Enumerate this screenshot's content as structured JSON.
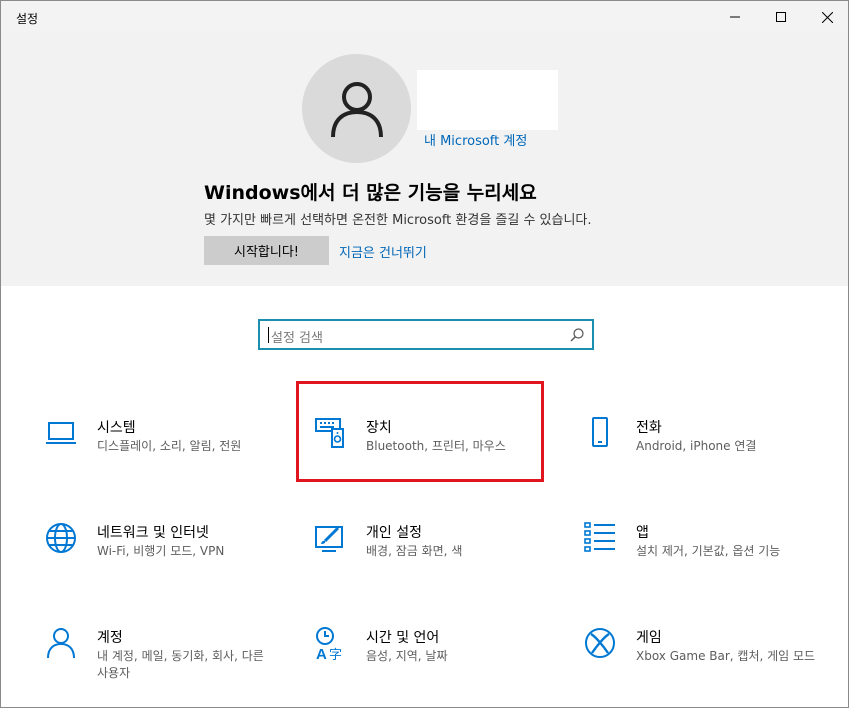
{
  "window": {
    "title": "설정"
  },
  "hero": {
    "account_link": "내 Microsoft 계정",
    "title": "Windows에서 더 많은 기능을 누리세요",
    "subtitle": "몇 가지만 빠르게 선택하면 온전한 Microsoft 환경을 즐길 수 있습니다.",
    "start_button": "시작합니다!",
    "skip_link": "지금은 건너뛰기"
  },
  "search": {
    "placeholder": "설정 검색"
  },
  "tiles": {
    "system": {
      "name": "시스템",
      "desc": "디스플레이, 소리, 알림, 전원"
    },
    "devices": {
      "name": "장치",
      "desc": "Bluetooth, 프린터, 마우스"
    },
    "phone": {
      "name": "전화",
      "desc": "Android, iPhone 연결"
    },
    "network": {
      "name": "네트워크 및 인터넷",
      "desc": "Wi-Fi, 비행기 모드, VPN"
    },
    "personalization": {
      "name": "개인 설정",
      "desc": "배경, 잠금 화면, 색"
    },
    "apps": {
      "name": "앱",
      "desc": "설치 제거, 기본값, 옵션 기능"
    },
    "accounts": {
      "name": "계정",
      "desc": "내 계정, 메일, 동기화, 회사, 다른 사용자"
    },
    "time_language": {
      "name": "시간 및 언어",
      "desc": "음성, 지역, 날짜"
    },
    "gaming": {
      "name": "게임",
      "desc": "Xbox Game Bar, 캡처, 게임 모드"
    }
  },
  "colors": {
    "accent": "#0067b8",
    "highlight": "#e0151f",
    "icon": "#0078d4"
  }
}
